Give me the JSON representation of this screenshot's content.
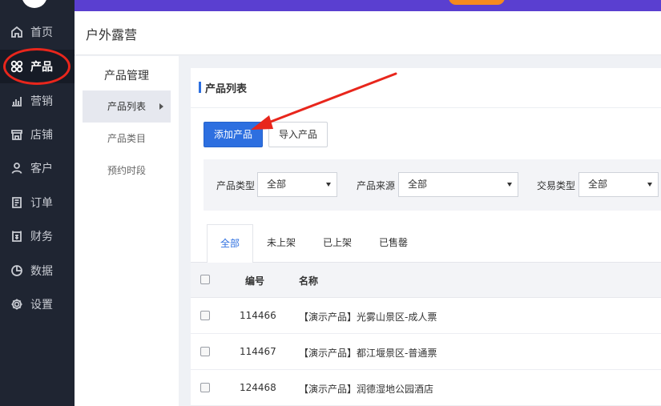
{
  "nav": {
    "items": [
      {
        "label": "首页",
        "icon": "home-icon"
      },
      {
        "label": "产品",
        "icon": "product-grid-icon"
      },
      {
        "label": "营销",
        "icon": "bar-chart-icon"
      },
      {
        "label": "店铺",
        "icon": "store-icon"
      },
      {
        "label": "客户",
        "icon": "user-icon"
      },
      {
        "label": "订单",
        "icon": "order-icon"
      },
      {
        "label": "财务",
        "icon": "finance-icon"
      },
      {
        "label": "数据",
        "icon": "pie-chart-icon"
      },
      {
        "label": "设置",
        "icon": "gear-icon"
      }
    ],
    "active": "产品"
  },
  "header": {
    "title": "户外露营"
  },
  "subnav": {
    "group_title": "产品管理",
    "items": [
      {
        "label": "产品列表"
      },
      {
        "label": "产品类目"
      },
      {
        "label": "预约时段"
      }
    ]
  },
  "panel": {
    "title": "产品列表",
    "add_button": "添加产品",
    "import_button": "导入产品"
  },
  "filters": {
    "type_label": "产品类型",
    "type_value": "全部",
    "source_label": "产品来源",
    "source_value": "全部",
    "trade_label": "交易类型",
    "trade_value": "全部"
  },
  "tabs": [
    {
      "label": "全部"
    },
    {
      "label": "未上架"
    },
    {
      "label": "已上架"
    },
    {
      "label": "已售罄"
    }
  ],
  "table": {
    "columns": {
      "code": "编号",
      "name": "名称"
    },
    "rows": [
      {
        "code": "114466",
        "name": "【演示产品】光雾山景区-成人票"
      },
      {
        "code": "114467",
        "name": "【演示产品】都江堰景区-普通票"
      },
      {
        "code": "124468",
        "name": "【演示产品】润德湿地公园酒店"
      }
    ]
  },
  "colors": {
    "nav_bg": "#1f2532",
    "accent": "#2d6fe0",
    "top_bar": "#5a3fd0",
    "annotation": "#e8261c"
  }
}
